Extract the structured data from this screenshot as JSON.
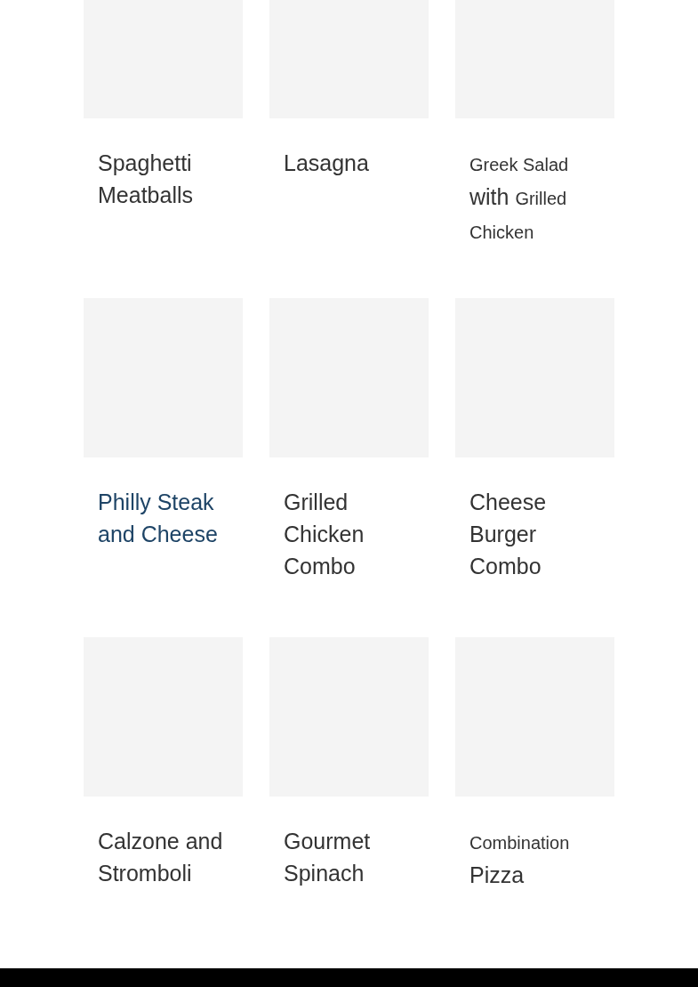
{
  "menu_items": [
    {
      "title_parts": [
        {
          "text": "Spaghetti Meatballs",
          "small": false
        }
      ],
      "highlighted": false
    },
    {
      "title_parts": [
        {
          "text": "Lasagna",
          "small": false
        }
      ],
      "highlighted": false
    },
    {
      "title_parts": [
        {
          "text": "Greek Salad",
          "small": true
        },
        {
          "text": " with ",
          "small": false
        },
        {
          "text": "Grilled Chicken",
          "small": true
        }
      ],
      "highlighted": false
    },
    {
      "title_parts": [
        {
          "text": "Philly Steak and Cheese",
          "small": false
        }
      ],
      "highlighted": true
    },
    {
      "title_parts": [
        {
          "text": "Grilled Chicken Combo",
          "small": false
        }
      ],
      "highlighted": false
    },
    {
      "title_parts": [
        {
          "text": "Cheese Burger Combo",
          "small": false
        }
      ],
      "highlighted": false
    },
    {
      "title_parts": [
        {
          "text": "Calzone and Stromboli",
          "small": false
        }
      ],
      "highlighted": false
    },
    {
      "title_parts": [
        {
          "text": "Gourmet Spinach",
          "small": false
        }
      ],
      "highlighted": false
    },
    {
      "title_parts": [
        {
          "text": "Combination",
          "small": true
        },
        {
          "text": " Pizza",
          "small": false
        }
      ],
      "highlighted": false
    }
  ]
}
